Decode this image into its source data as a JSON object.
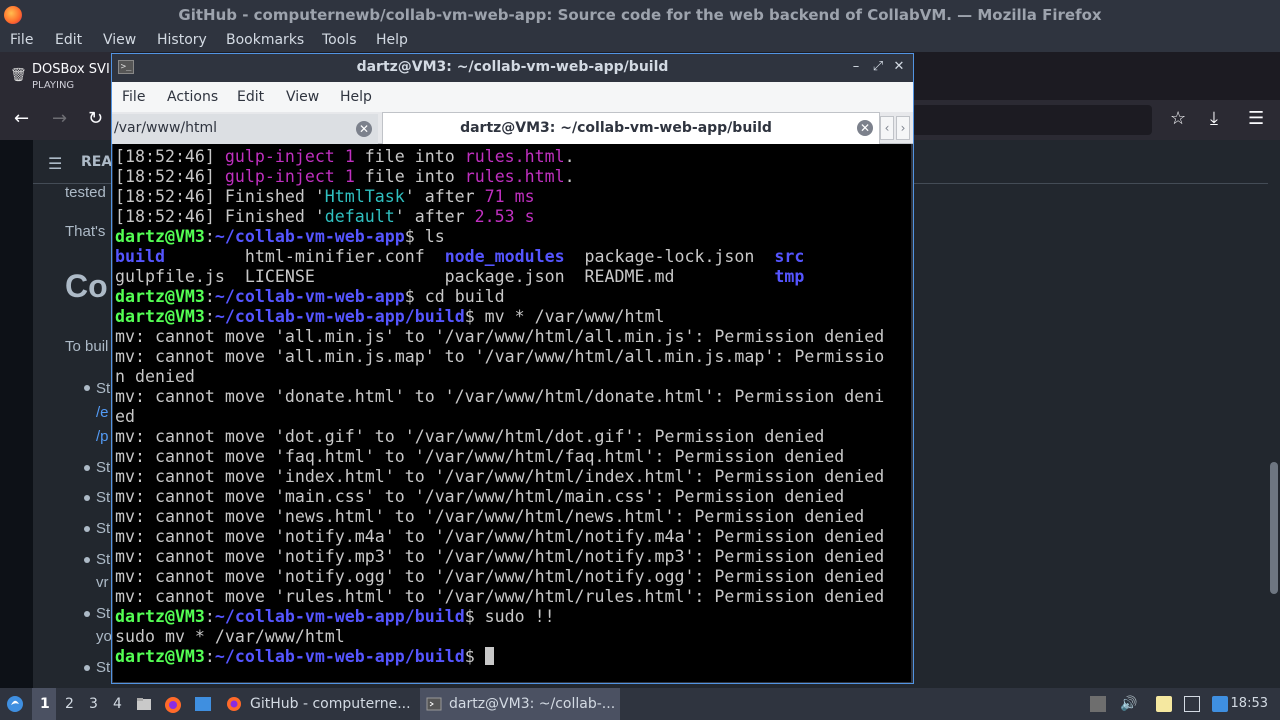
{
  "firefox": {
    "window_title": "GitHub - computernewb/collab-vm-web-app: Source code for the web backend of CollabVM. — Mozilla Firefox",
    "menu": [
      "File",
      "Edit",
      "View",
      "History",
      "Bookmarks",
      "Tools",
      "Help"
    ],
    "tab": {
      "title": "DOSBox SVI",
      "subtitle": "PLAYING"
    },
    "nav": {
      "back": "←",
      "forward": "→",
      "reload": "↻",
      "bookmark": "☆",
      "downloads": "⤓",
      "menu": "☰"
    }
  },
  "page": {
    "readme_label": "REA",
    "text_tested": "tested",
    "text_thats": "That's",
    "heading": "Co",
    "text_tobuild": "To buil",
    "bullet1": "St",
    "bullet1_link1": "/e",
    "bullet1_link2": "/p",
    "bullet2": "St",
    "bullet3": "St",
    "bullet4": "St",
    "bullet5": "St",
    "bullet5_cont": "vr",
    "bullet6": "St",
    "bullet6_cont": "yo",
    "bullet7": "St"
  },
  "terminal": {
    "title": "dartz@VM3: ~/collab-vm-web-app/build",
    "menu": [
      "File",
      "Actions",
      "Edit",
      "View",
      "Help"
    ],
    "tabs": [
      {
        "label": "/var/www/html",
        "active": false
      },
      {
        "label": "dartz@VM3: ~/collab-vm-web-app/build",
        "active": true
      }
    ],
    "lines": [
      [
        [
          "c-white",
          "[18:52:46] "
        ],
        [
          "c-magenta",
          "gulp-inject"
        ],
        [
          "c-white",
          " "
        ],
        [
          "c-magenta",
          "1"
        ],
        [
          "c-white",
          " file into "
        ],
        [
          "c-magenta",
          "rules.html"
        ],
        [
          "c-white",
          "."
        ]
      ],
      [
        [
          "c-white",
          "[18:52:46] "
        ],
        [
          "c-magenta",
          "gulp-inject"
        ],
        [
          "c-white",
          " "
        ],
        [
          "c-magenta",
          "1"
        ],
        [
          "c-white",
          " file into "
        ],
        [
          "c-magenta",
          "rules.html"
        ],
        [
          "c-white",
          "."
        ]
      ],
      [
        [
          "c-white",
          "[18:52:46] Finished '"
        ],
        [
          "c-cyan",
          "HtmlTask"
        ],
        [
          "c-white",
          "' after "
        ],
        [
          "c-magenta",
          "71 ms"
        ]
      ],
      [
        [
          "c-white",
          "[18:52:46] Finished '"
        ],
        [
          "c-cyan",
          "default"
        ],
        [
          "c-white",
          "' after "
        ],
        [
          "c-magenta",
          "2.53 s"
        ]
      ],
      [
        [
          "c-green",
          "dartz@VM3"
        ],
        [
          "c-white",
          ":"
        ],
        [
          "c-blue",
          "~/collab-vm-web-app"
        ],
        [
          "c-white",
          "$ ls"
        ]
      ],
      [
        [
          "c-blue",
          "build"
        ],
        [
          "c-white",
          "        html-minifier.conf  "
        ],
        [
          "c-blue",
          "node_modules"
        ],
        [
          "c-white",
          "  package-lock.json  "
        ],
        [
          "c-blue",
          "src"
        ]
      ],
      [
        [
          "c-white",
          "gulpfile.js  LICENSE             package.json  README.md          "
        ],
        [
          "c-blue",
          "tmp"
        ]
      ],
      [
        [
          "c-green",
          "dartz@VM3"
        ],
        [
          "c-white",
          ":"
        ],
        [
          "c-blue",
          "~/collab-vm-web-app"
        ],
        [
          "c-white",
          "$ cd build"
        ]
      ],
      [
        [
          "c-green",
          "dartz@VM3"
        ],
        [
          "c-white",
          ":"
        ],
        [
          "c-blue",
          "~/collab-vm-web-app/build"
        ],
        [
          "c-white",
          "$ mv * /var/www/html"
        ]
      ],
      [
        [
          "c-white",
          "mv: cannot move 'all.min.js' to '/var/www/html/all.min.js': Permission denied"
        ]
      ],
      [
        [
          "c-white",
          "mv: cannot move 'all.min.js.map' to '/var/www/html/all.min.js.map': Permissio"
        ]
      ],
      [
        [
          "c-white",
          "n denied"
        ]
      ],
      [
        [
          "c-white",
          "mv: cannot move 'donate.html' to '/var/www/html/donate.html': Permission deni"
        ]
      ],
      [
        [
          "c-white",
          "ed"
        ]
      ],
      [
        [
          "c-white",
          "mv: cannot move 'dot.gif' to '/var/www/html/dot.gif': Permission denied"
        ]
      ],
      [
        [
          "c-white",
          "mv: cannot move 'faq.html' to '/var/www/html/faq.html': Permission denied"
        ]
      ],
      [
        [
          "c-white",
          "mv: cannot move 'index.html' to '/var/www/html/index.html': Permission denied"
        ]
      ],
      [
        [
          "c-white",
          "mv: cannot move 'main.css' to '/var/www/html/main.css': Permission denied"
        ]
      ],
      [
        [
          "c-white",
          "mv: cannot move 'news.html' to '/var/www/html/news.html': Permission denied"
        ]
      ],
      [
        [
          "c-white",
          "mv: cannot move 'notify.m4a' to '/var/www/html/notify.m4a': Permission denied"
        ]
      ],
      [
        [
          "c-white",
          "mv: cannot move 'notify.mp3' to '/var/www/html/notify.mp3': Permission denied"
        ]
      ],
      [
        [
          "c-white",
          "mv: cannot move 'notify.ogg' to '/var/www/html/notify.ogg': Permission denied"
        ]
      ],
      [
        [
          "c-white",
          "mv: cannot move 'rules.html' to '/var/www/html/rules.html': Permission denied"
        ]
      ],
      [
        [
          "c-green",
          "dartz@VM3"
        ],
        [
          "c-white",
          ":"
        ],
        [
          "c-blue",
          "~/collab-vm-web-app/build"
        ],
        [
          "c-white",
          "$ sudo !!"
        ]
      ],
      [
        [
          "c-white",
          "sudo mv * /var/www/html"
        ]
      ],
      [
        [
          "c-green",
          "dartz@VM3"
        ],
        [
          "c-white",
          ":"
        ],
        [
          "c-blue",
          "~/collab-vm-web-app/build"
        ],
        [
          "c-white",
          "$ "
        ]
      ]
    ]
  },
  "taskbar": {
    "workspaces": [
      "1",
      "2",
      "3",
      "4"
    ],
    "active_workspace": "1",
    "apps": [
      {
        "label": "GitHub - computerne...",
        "icon": "firefox-icon"
      },
      {
        "label": "dartz@VM3: ~/collab-...",
        "icon": "terminal-icon"
      }
    ],
    "clock": "18:53"
  }
}
